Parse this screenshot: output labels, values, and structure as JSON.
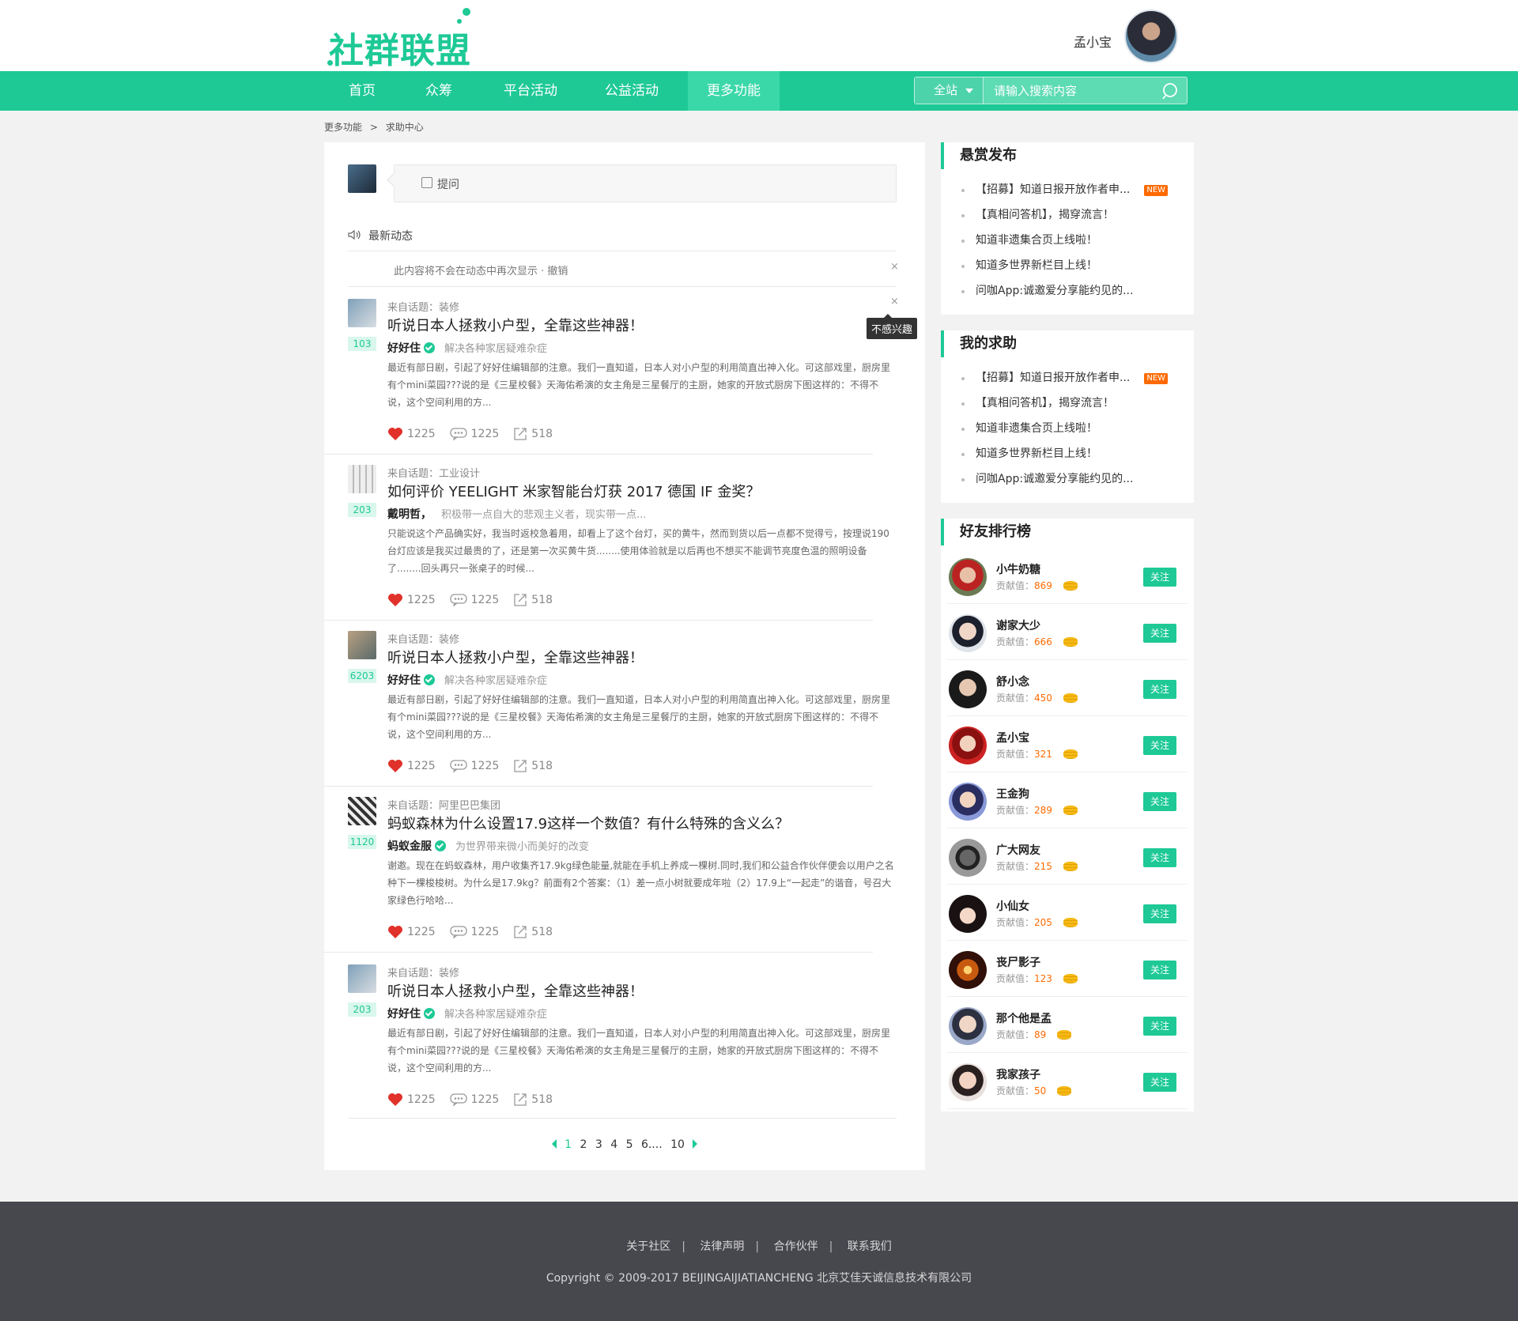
{
  "header": {
    "logo_text": "社群联盟",
    "user_name": "孟小宝"
  },
  "nav": {
    "items": [
      "首页",
      "众筹",
      "平台活动",
      "公益活动",
      "更多功能"
    ],
    "active": "更多功能"
  },
  "search": {
    "scope": "全站",
    "placeholder": "请输入搜索内容"
  },
  "breadcrumb": {
    "parent": "更多功能",
    "sep": ">",
    "current": "求助中心"
  },
  "ask": {
    "label": "提问"
  },
  "latest": {
    "title": "最新动态",
    "dismissed_text": "此内容将不会在动态中再次显示 · 撤销",
    "close": "×",
    "tooltip": "不感兴趣"
  },
  "feed": [
    {
      "topic": "来自话题：装修",
      "title": "听说日本人拯救小户型，全靠这些神器！",
      "badge": "103",
      "author": "好好住",
      "verified": true,
      "motto": "解决各种家居疑难杂症",
      "body": "最近有部日剧，引起了好好住编辑部的注意。我们一直知道，日本人对小户型的利用简直出神入化。可这部戏里，厨房里有个mini菜园???说的是《三星校餐》天海佑希演的女主角是三星餐厅的主厨，她家的开放式厨房下图这样的：不得不说，这个空间利用的方...",
      "likes": "1225",
      "comments": "1225",
      "shares": "518"
    },
    {
      "topic": "来自话题：工业设计",
      "title": "如何评价 YEELIGHT 米家智能台灯获 2017 德国 IF 金奖？",
      "badge": "203",
      "author": "戴明哲，",
      "verified": false,
      "motto": "积极带一点自大的悲观主义者，现实带一点...",
      "body": "只能说这个产品确实好，我当时返校急着用，却看上了这个台灯，买的黄牛，然而到货以后一点都不觉得亏，按理说190台灯应该是我买过最贵的了，还是第一次买黄牛货........使用体验就是以后再也不想买不能调节亮度色温的照明设备了........回头再只一张桌子的时候...",
      "likes": "1225",
      "comments": "1225",
      "shares": "518"
    },
    {
      "topic": "来自话题：装修",
      "title": "听说日本人拯救小户型，全靠这些神器！",
      "badge": "6203",
      "author": "好好住",
      "verified": true,
      "motto": "解决各种家居疑难杂症",
      "body": "最近有部日剧，引起了好好住编辑部的注意。我们一直知道，日本人对小户型的利用简直出神入化。可这部戏里，厨房里有个mini菜园???说的是《三星校餐》天海佑希演的女主角是三星餐厅的主厨，她家的开放式厨房下图这样的：不得不说，这个空间利用的方...",
      "likes": "1225",
      "comments": "1225",
      "shares": "518"
    },
    {
      "topic": "来自话题：阿里巴巴集团",
      "title": "蚂蚁森林为什么设置17.9这样一个数值？有什么特殊的含义么？",
      "badge": "1120",
      "author": "蚂蚁金服",
      "verified": true,
      "motto": "为世界带来微小而美好的改变",
      "body": "谢邀。现在在蚂蚁森林，用户收集齐17.9kg绿色能量,就能在手机上养成一棵树.同时,我们和公益合作伙伴便会以用户之名种下一棵梭梭树。为什么是17.9kg？前面有2个答案：（1）差一点小树就要成年啦（2）17.9上“一起走”的谐音，号召大家绿色行哈哈...",
      "likes": "1225",
      "comments": "1225",
      "shares": "518"
    },
    {
      "topic": "来自话题：装修",
      "title": "听说日本人拯救小户型，全靠这些神器！",
      "badge": "203",
      "author": "好好住",
      "verified": true,
      "motto": "解决各种家居疑难杂症",
      "body": "最近有部日剧，引起了好好住编辑部的注意。我们一直知道，日本人对小户型的利用简直出神入化。可这部戏里，厨房里有个mini菜园???说的是《三星校餐》天海佑希演的女主角是三星餐厅的主厨，她家的开放式厨房下图这样的：不得不说，这个空间利用的方...",
      "likes": "1225",
      "comments": "1225",
      "shares": "518"
    }
  ],
  "pager": {
    "pages": [
      "1",
      "2",
      "3",
      "4",
      "5",
      "6....",
      "10"
    ],
    "current": "1"
  },
  "bounty": {
    "title": "悬赏发布",
    "items": [
      "【招募】知道日报开放作者申...",
      "【真相问答机】，揭穿流言！",
      "知道非遗集合页上线啦！",
      "知道多世界新栏目上线！",
      "问咖App:诚邀爱分享能约见的..."
    ],
    "new_tag": "NEW"
  },
  "my_help": {
    "title": "我的求助",
    "items": [
      "【招募】知道日报开放作者申...",
      "【真相问答机】，揭穿流言！",
      "知道非遗集合页上线啦！",
      "知道多世界新栏目上线！",
      "问咖App:诚邀爱分享能约见的..."
    ],
    "new_tag": "NEW"
  },
  "ranking": {
    "title": "好友排行榜",
    "score_label": "贡献值：",
    "follow_label": "关注",
    "items": [
      {
        "name": "小牛奶糖",
        "score": "869"
      },
      {
        "name": "谢家大少",
        "score": "666"
      },
      {
        "name": "舒小念",
        "score": "450"
      },
      {
        "name": "孟小宝",
        "score": "321"
      },
      {
        "name": "王金狗",
        "score": "289"
      },
      {
        "name": "广大网友",
        "score": "215"
      },
      {
        "name": "小仙女",
        "score": "205"
      },
      {
        "name": "丧尸影子",
        "score": "123"
      },
      {
        "name": "那个他是孟",
        "score": "89"
      },
      {
        "name": "我家孩子",
        "score": "50"
      }
    ]
  },
  "footer": {
    "links": [
      "关于社区",
      "法律声明",
      "合作伙伴",
      "联系我们"
    ],
    "copyright": "Copyright © 2009-2017 BEIJINGAIJIATIANCHENG 北京艾佳天诚信息技术有限公司"
  },
  "colors": {
    "brand": "#1ec996",
    "accent_orange": "#ff6a00",
    "footer_bg": "#47484e"
  }
}
